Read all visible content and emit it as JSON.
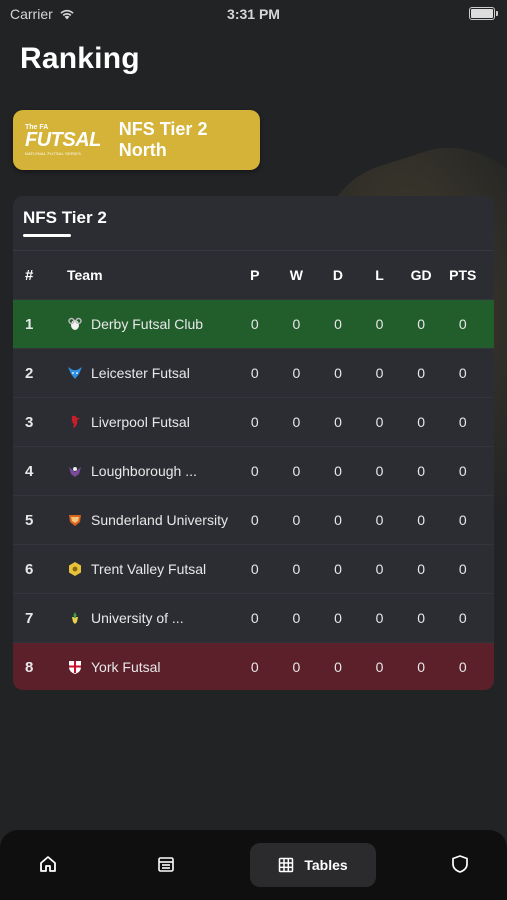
{
  "status_bar": {
    "carrier": "Carrier",
    "time": "3:31 PM"
  },
  "page": {
    "title": "Ranking"
  },
  "league": {
    "name": "NFS Tier 2 North",
    "logo": {
      "top": "The FA",
      "main": "FUTSAL",
      "sub": "NATIONAL FUTSAL SERIES"
    }
  },
  "table": {
    "title": "NFS Tier 2",
    "headers": {
      "pos": "#",
      "team": "Team",
      "p": "P",
      "w": "W",
      "d": "D",
      "l": "L",
      "gd": "GD",
      "pts": "PTS"
    },
    "rows": [
      {
        "pos": "1",
        "team": "Derby Futsal Club",
        "crest": "ram-crest-icon",
        "p": "0",
        "w": "0",
        "d": "0",
        "l": "0",
        "gd": "0",
        "pts": "0",
        "zone": "promotion"
      },
      {
        "pos": "2",
        "team": "Leicester Futsal",
        "crest": "fox-crest-icon",
        "p": "0",
        "w": "0",
        "d": "0",
        "l": "0",
        "gd": "0",
        "pts": "0",
        "zone": ""
      },
      {
        "pos": "3",
        "team": "Liverpool Futsal",
        "crest": "liver-bird-crest-icon",
        "p": "0",
        "w": "0",
        "d": "0",
        "l": "0",
        "gd": "0",
        "pts": "0",
        "zone": ""
      },
      {
        "pos": "4",
        "team": "Loughborough ...",
        "crest": "loughborough-crest-icon",
        "p": "0",
        "w": "0",
        "d": "0",
        "l": "0",
        "gd": "0",
        "pts": "0",
        "zone": ""
      },
      {
        "pos": "5",
        "team": "Sunderland University",
        "crest": "sunderland-crest-icon",
        "p": "0",
        "w": "0",
        "d": "0",
        "l": "0",
        "gd": "0",
        "pts": "0",
        "zone": ""
      },
      {
        "pos": "6",
        "team": "Trent Valley Futsal",
        "crest": "hexagon-crest-icon",
        "p": "0",
        "w": "0",
        "d": "0",
        "l": "0",
        "gd": "0",
        "pts": "0",
        "zone": ""
      },
      {
        "pos": "7",
        "team": "University of ...",
        "crest": "university-crest-icon",
        "p": "0",
        "w": "0",
        "d": "0",
        "l": "0",
        "gd": "0",
        "pts": "0",
        "zone": ""
      },
      {
        "pos": "8",
        "team": "York Futsal",
        "crest": "york-shield-crest-icon",
        "p": "0",
        "w": "0",
        "d": "0",
        "l": "0",
        "gd": "0",
        "pts": "0",
        "zone": "relegation"
      }
    ]
  },
  "tabbar": {
    "items": [
      {
        "id": "home",
        "icon": "home-icon"
      },
      {
        "id": "fixtures",
        "icon": "calendar-icon"
      },
      {
        "id": "tables",
        "icon": "table-grid-icon",
        "label": "Tables",
        "active": true
      },
      {
        "id": "clubs",
        "icon": "shield-icon"
      }
    ]
  },
  "colors": {
    "background": "#222325",
    "card": "#2b2d33",
    "accent_gold": "#d4b338",
    "promotion": "#215e2c",
    "relegation": "#5b2029"
  }
}
